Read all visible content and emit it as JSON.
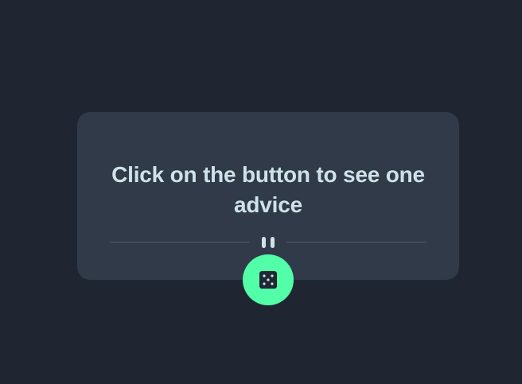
{
  "advice": {
    "text": "Click on the button to see one advice"
  },
  "controls": {
    "divider_icon": "pause-icon",
    "dice_icon": "dice-icon"
  },
  "colors": {
    "background": "#1f2632",
    "card": "#313a48",
    "text": "#cee3e9",
    "accent": "#52ffa8",
    "divider": "#4f5b69"
  }
}
